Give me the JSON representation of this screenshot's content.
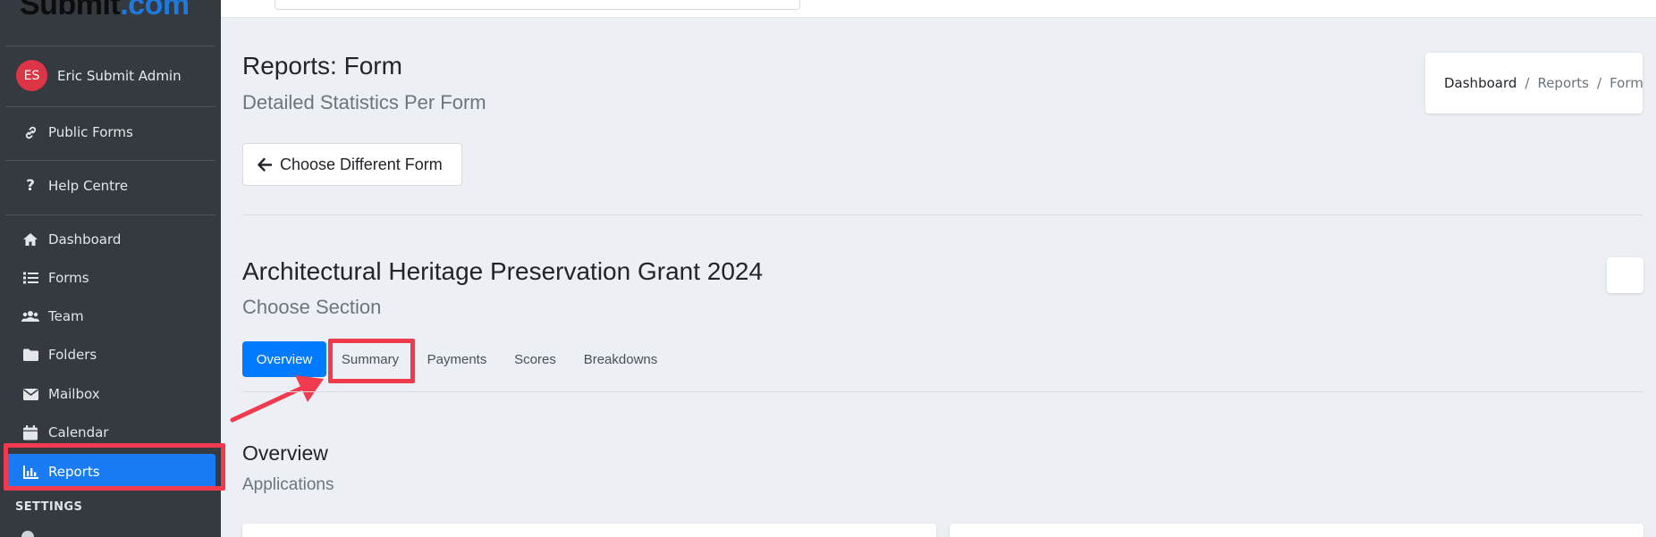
{
  "app": {
    "logo_text": "Submit",
    "logo_suffix": ".com"
  },
  "user": {
    "initials": "ES",
    "name": "Eric Submit Admin",
    "avatar_color": "#dc3545"
  },
  "sidebar": {
    "items": [
      {
        "label": "Public Forms",
        "icon": "link-icon"
      },
      {
        "label": "Help Centre",
        "icon": "question-icon"
      },
      {
        "label": "Dashboard",
        "icon": "home-icon"
      },
      {
        "label": "Forms",
        "icon": "list-icon"
      },
      {
        "label": "Team",
        "icon": "users-icon"
      },
      {
        "label": "Folders",
        "icon": "folder-icon"
      },
      {
        "label": "Mailbox",
        "icon": "envelope-icon"
      },
      {
        "label": "Calendar",
        "icon": "calendar-icon"
      },
      {
        "label": "Reports",
        "icon": "chart-bar-icon",
        "active": true
      }
    ],
    "settings_header": "SETTINGS"
  },
  "page": {
    "title": "Reports: Form",
    "subtitle": "Detailed Statistics Per Form"
  },
  "breadcrumb": {
    "items": [
      "Dashboard",
      "Reports",
      "Form"
    ],
    "separator": "/"
  },
  "back_button": {
    "label": "Choose Different Form"
  },
  "form": {
    "title": "Architectural Heritage Preservation Grant 2024",
    "subtitle": "Choose Section"
  },
  "tabs": [
    {
      "label": "Overview",
      "active": true
    },
    {
      "label": "Summary",
      "highlighted": true
    },
    {
      "label": "Payments"
    },
    {
      "label": "Scores"
    },
    {
      "label": "Breakdowns"
    }
  ],
  "section": {
    "title": "Overview",
    "subtitle": "Applications"
  },
  "colors": {
    "sidebar_bg": "#343a40",
    "accent": "#007bff",
    "annotation": "#f23a4e"
  }
}
